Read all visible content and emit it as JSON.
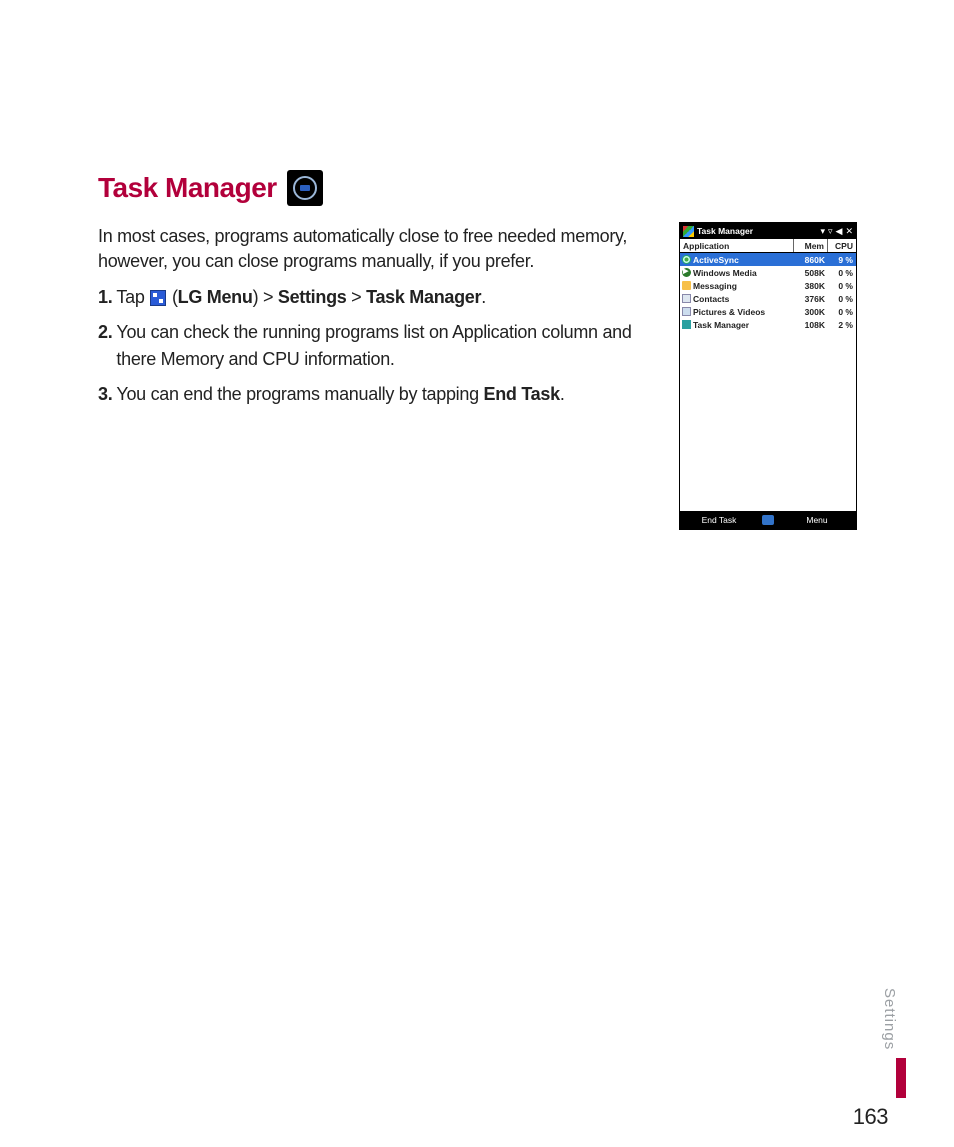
{
  "heading": "Task Manager",
  "intro": "In most cases, programs automatically close to free needed memory, however, you can close programs manually, if you prefer.",
  "steps": {
    "s1_num": "1.",
    "s1_pre": "Tap ",
    "s1_paren_open": "(",
    "s1_lgmenu": "LG Menu",
    "s1_paren_close": ") > ",
    "s1_settings": "Settings",
    "s1_gt": " > ",
    "s1_tm": "Task Manager",
    "s1_period": ".",
    "s2_num": "2.",
    "s2_text": "You can check the running programs list on Application column and there Memory and CPU information.",
    "s3_num": "3.",
    "s3_pre": "You can end the programs manually by tapping ",
    "s3_bold": "End Task",
    "s3_period": "."
  },
  "device": {
    "title": "Task Manager",
    "signal_icons": "▾   ▿ ◀✕",
    "columns": {
      "app": "Application",
      "mem": "Mem",
      "cpu": "CPU"
    },
    "rows": [
      {
        "app": "ActiveSync",
        "mem": "860K",
        "cpu": "9 %",
        "icon": "sync",
        "selected": true
      },
      {
        "app": "Windows Media",
        "mem": "508K",
        "cpu": "0 %",
        "icon": "wm",
        "selected": false
      },
      {
        "app": "Messaging",
        "mem": "380K",
        "cpu": "0 %",
        "icon": "msg",
        "selected": false
      },
      {
        "app": "Contacts",
        "mem": "376K",
        "cpu": "0 %",
        "icon": "ct",
        "selected": false
      },
      {
        "app": "Pictures & Videos",
        "mem": "300K",
        "cpu": "0 %",
        "icon": "pv",
        "selected": false
      },
      {
        "app": "Task Manager",
        "mem": "108K",
        "cpu": "2 %",
        "icon": "tm",
        "selected": false
      }
    ],
    "softkeys": {
      "left": "End Task",
      "right": "Menu"
    }
  },
  "side_tab": "Settings",
  "page_number": "163"
}
